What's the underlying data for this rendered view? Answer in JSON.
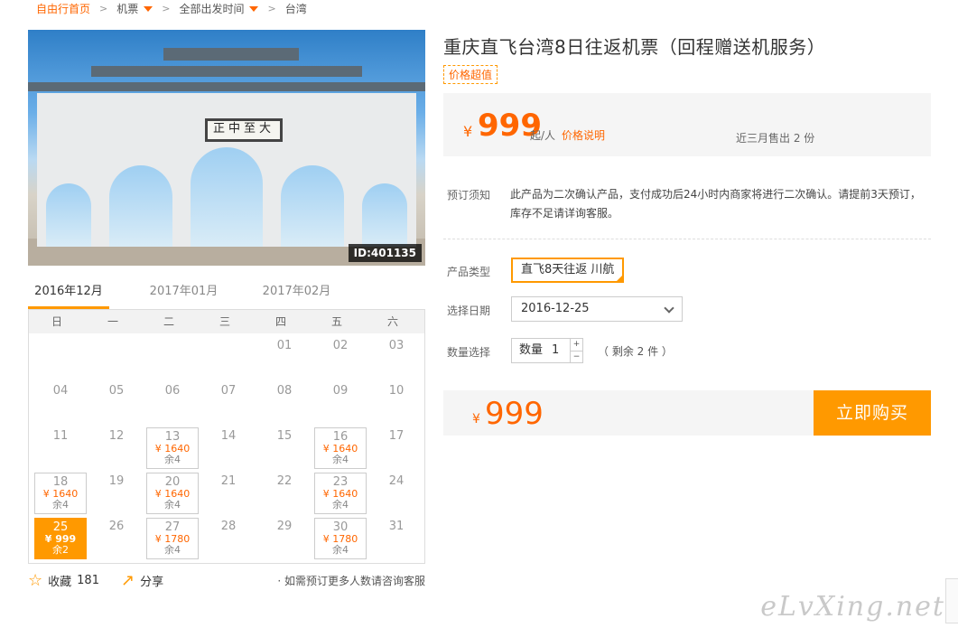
{
  "breadcrumb": {
    "home": "自由行首页",
    "item1": "机票",
    "item2": "全部出发时间",
    "item3": "台湾"
  },
  "photo": {
    "plaque": "正中至大",
    "id_badge": "ID:401135"
  },
  "calendar": {
    "tabs": [
      "2016年12月",
      "2017年01月",
      "2017年02月"
    ],
    "weekdays": [
      "日",
      "一",
      "二",
      "三",
      "四",
      "五",
      "六"
    ],
    "cells": [
      {
        "d": ""
      },
      {
        "d": ""
      },
      {
        "d": ""
      },
      {
        "d": ""
      },
      {
        "d": "01"
      },
      {
        "d": "02"
      },
      {
        "d": "03"
      },
      {
        "d": "04"
      },
      {
        "d": "05"
      },
      {
        "d": "06"
      },
      {
        "d": "07"
      },
      {
        "d": "08"
      },
      {
        "d": "09"
      },
      {
        "d": "10"
      },
      {
        "d": "11"
      },
      {
        "d": "12"
      },
      {
        "d": "13",
        "price": "¥ 1640",
        "left": "余4"
      },
      {
        "d": "14"
      },
      {
        "d": "15"
      },
      {
        "d": "16",
        "price": "¥ 1640",
        "left": "余4"
      },
      {
        "d": "17"
      },
      {
        "d": "18",
        "price": "¥ 1640",
        "left": "余4"
      },
      {
        "d": "19"
      },
      {
        "d": "20",
        "price": "¥ 1640",
        "left": "余4"
      },
      {
        "d": "21"
      },
      {
        "d": "22"
      },
      {
        "d": "23",
        "price": "¥ 1640",
        "left": "余4"
      },
      {
        "d": "24"
      },
      {
        "d": "25",
        "price": "¥ 999",
        "left": "余2",
        "selected": true
      },
      {
        "d": "26"
      },
      {
        "d": "27",
        "price": "¥ 1780",
        "left": "余4"
      },
      {
        "d": "28"
      },
      {
        "d": "29"
      },
      {
        "d": "30",
        "price": "¥ 1780",
        "left": "余4"
      },
      {
        "d": "31"
      }
    ]
  },
  "actions": {
    "favorite_label": "收藏",
    "favorite_count": "181",
    "share_label": "分享",
    "tip": "· 如需预订更多人数请咨询客服"
  },
  "product": {
    "title": "重庆直飞台湾8日往返机票（回程赠送机服务）",
    "tag": "价格超值",
    "currency": "¥",
    "price": "999",
    "unit": "起/人",
    "price_explain": "价格说明",
    "sold": "近三月售出 2 份"
  },
  "notice": {
    "label": "预订须知",
    "text": "此产品为二次确认产品，支付成功后24小时内商家将进行二次确认。请提前3天预订，库存不足请详询客服。"
  },
  "form": {
    "type_label": "产品类型",
    "type_value": "直飞8天往返 川航",
    "date_label": "选择日期",
    "date_value": "2016-12-25",
    "qty_label": "数量选择",
    "qty_prefix": "数量",
    "qty_value": "1",
    "qty_plus": "+",
    "qty_minus": "−",
    "remain": "（ 剩余 2 件 ）"
  },
  "buy": {
    "currency": "¥",
    "price": "999",
    "button": "立即购买"
  },
  "watermark": "eLvXing.net",
  "colors": {
    "accent": "#ff9900",
    "price": "#ff6600"
  }
}
